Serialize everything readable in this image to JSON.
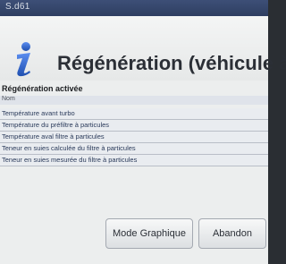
{
  "window": {
    "title": "S.d61"
  },
  "header": {
    "title": "Régénération (véhicule à"
  },
  "section": {
    "title": "Régénération activée",
    "column_header": "Nom",
    "rows": [
      {
        "label": "Température avant turbo"
      },
      {
        "label": "Température du préfiltre à particules"
      },
      {
        "label": "Température aval filtre à particules"
      },
      {
        "label": "Teneur en suies calculée du filtre à particules"
      },
      {
        "label": "Teneur en suies mesurée du filtre à particules"
      }
    ]
  },
  "buttons": {
    "graph_mode": "Mode Graphique",
    "cancel": "Abandon"
  },
  "icon": "info-icon",
  "colors": {
    "titlebar": "#2e3e61",
    "icon_blue": "#2f63c8",
    "row_bg": "#e9ecf0"
  }
}
